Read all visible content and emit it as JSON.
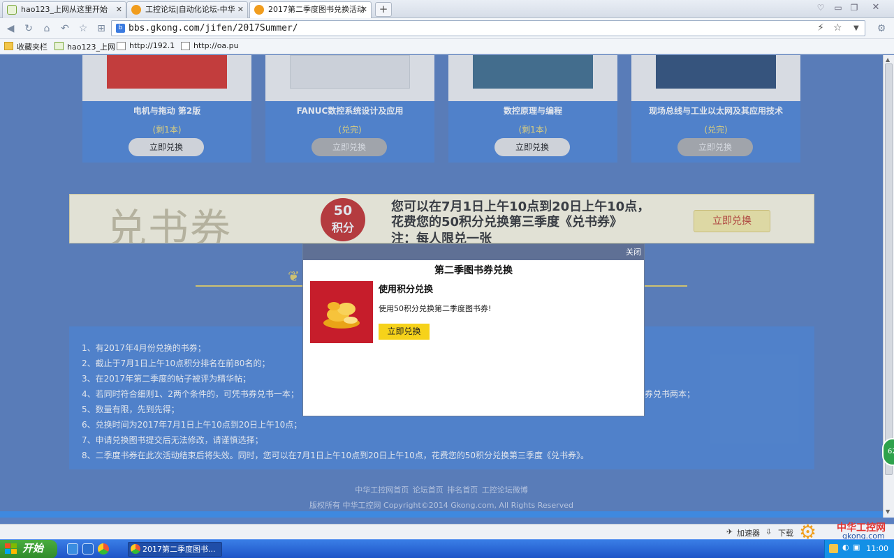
{
  "browser": {
    "tabs": [
      {
        "label": "hao123_上网从这里开始",
        "active": false
      },
      {
        "label": "工控论坛|自动化论坛-中华",
        "active": false
      },
      {
        "label": "2017第二季度图书兑换活动",
        "active": true
      }
    ],
    "new_tab": "+",
    "url": "bbs.gkong.com/jifen/2017Summer/",
    "bookmarks": [
      "收藏夹栏",
      "hao123_上网",
      "http://192.1",
      "http://oa.pu"
    ]
  },
  "books": [
    {
      "title": "电机与拖动 第2版",
      "status": "(剩1本)",
      "button": "立即兑换",
      "enabled": true
    },
    {
      "title": "FANUC数控系统设计及应用",
      "status": "(兑完)",
      "button": "立即兑换",
      "enabled": false
    },
    {
      "title": "数控原理与编程",
      "status": "(剩1本)",
      "button": "立即兑换",
      "enabled": true
    },
    {
      "title": "现场总线与工业以太网及其应用技术",
      "status": "(兑完)",
      "button": "立即兑换",
      "enabled": false
    }
  ],
  "banner": {
    "big_text": "兑书券",
    "badge_number": "50",
    "badge_unit": "积分",
    "line1": "您可以在7月1日上午10点到20日上午10点，",
    "line2": "花费您的50积分兑换第三季度《兑书券》",
    "line3": "注：每人限兑一张",
    "button": "立即兑换"
  },
  "rules": [
    "1、有2017年4月份兑换的书券；",
    "2、截止于7月1日上午10点积分排名在前80名的；",
    "3、在2017年第二季度的帖子被评为精华帖；",
    "4、若同时符合细则1、2两个条件的，可凭书券兑书一本；",
    "券兑书两本；",
    "5、数量有限，先到先得；",
    "6、兑换时间为2017年7月1日上午10点到20日上午10点；",
    "7、申请兑换图书提交后无法修改，请谨慎选择；",
    "8、二季度书券在此次活动结束后将失效。同时，您可以在7月1日上午10点到20日上午10点，花费您的50积分兑换第三季度《兑书券》。"
  ],
  "footer": {
    "links": [
      "中华工控网首页",
      "论坛首页",
      "排名首页",
      "工控论坛微博"
    ],
    "copyright": "版权所有 中华工控网 Copyright©2014 Gkong.com, All Rights Reserved"
  },
  "modal": {
    "close": "关闭",
    "title": "第二季图书券兑换",
    "heading": "使用积分兑换",
    "description": "使用50积分兑换第二季度图书券!",
    "button": "立即兑换"
  },
  "statusbar": {
    "accelerator": "加速器",
    "download": "下载",
    "brand": "中华工控网",
    "brand_url": "gkong.com"
  },
  "taskbar": {
    "start": "开始",
    "task": "2017第二季度图书...",
    "clock": "11:00",
    "side_badge": "62"
  },
  "colors": {
    "page_bg": "#5a7fc0",
    "card_bg": "#4f86d6",
    "accent_yellow": "#f6d21a",
    "badge_red": "#c9302c"
  }
}
